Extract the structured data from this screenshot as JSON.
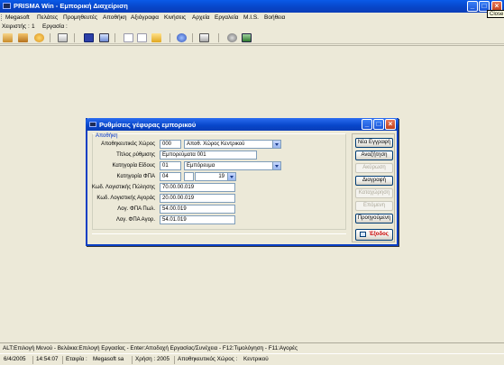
{
  "window": {
    "title": "PRISMA Win - Εμπορική Διαχείριση",
    "minimize_label": "_",
    "maximize_label": "□",
    "close_label": "×",
    "tooltip": "Close"
  },
  "menu": {
    "items": [
      "Megasoft",
      "Πελάτες",
      "Προμηθευτές",
      "Αποθήκη",
      "Αξιόγραφα",
      "Κινήσεις",
      "Αρχεία",
      "Εργαλεία",
      "M.I.S.",
      "Βοήθεια"
    ]
  },
  "status_line": {
    "user_label": "Χειριστής :",
    "user_value": "1",
    "task_label": "Εργασία :"
  },
  "toolbar": {
    "icons": [
      "people-icon",
      "binoculars-icon",
      "globe-icon",
      "keyboard-icon",
      "save-icon",
      "image-icon",
      "document-icon",
      "copy-icon",
      "folder-icon",
      "search-icon",
      "printer-icon",
      "settings-icon",
      "exit-icon"
    ]
  },
  "dialog": {
    "title": "Ρυθμίσεις γέφυρας εμπορικού",
    "group_label": "Αποθήκη",
    "fields": {
      "warehouse_label": "Αποθηκευτικός Χώρος",
      "warehouse_code": "000",
      "warehouse_name": "Αποθ. Χώρος Κεντρικού",
      "title_label": "Τίτλος ρύθμισης",
      "title_value": "Εμπορεύματα 001",
      "category_label": "Κατηγορία Είδους",
      "category_code": "01",
      "category_name": "Εμπόρευμα",
      "vat_label": "Κατηγορία ΦΠΑ",
      "vat_code": "04",
      "vat_rate": "19",
      "acc_sales_label": "Κωδ. Λογιστικής Πώλησης",
      "acc_sales_value": "70.00.00.019",
      "acc_purch_label": "Κωδ. Λογιστικής Αγοράς",
      "acc_purch_value": "20.00.00.019",
      "vat_sales_label": "Λογ. ΦΠΑ Πωλ.",
      "vat_sales_value": "54.00.019",
      "vat_purch_label": "Λογ. ΦΠΑ Αγορ.",
      "vat_purch_value": "54.01.019"
    },
    "buttons": {
      "new": "Νέα Εγγραφή",
      "search": "Αναζήτηση",
      "cancel": "Ακύρωση",
      "delete": "Διαγραφή",
      "save": "Καταχώρηση",
      "next": "Επόμενη",
      "previous": "Προηγούμενη",
      "exit": "Έξοδος"
    }
  },
  "hint_bar": {
    "text": "ALT:Επιλογή Μενού - Βελάκια:Επιλογή Εργασίας - Enter:Αποδοχή Εργασίας/Συνέχεια - F12:Τιμολόγηση - F11:Αγορές"
  },
  "status_bar": {
    "date": "6/4/2005",
    "time": "14:54:07",
    "company_label": "Εταιρία :",
    "company_value": "Megasoft sa",
    "year_label": "Χρήση :",
    "year_value": "2005",
    "warehouse_label": "Αποθηκευτικός Χώρος :",
    "warehouse_value": "Κεντρικού"
  },
  "colors": {
    "titlebar": "#0746c9",
    "background": "#ece9d8",
    "group_label": "#0033cc",
    "exit_text": "#cc0000"
  }
}
